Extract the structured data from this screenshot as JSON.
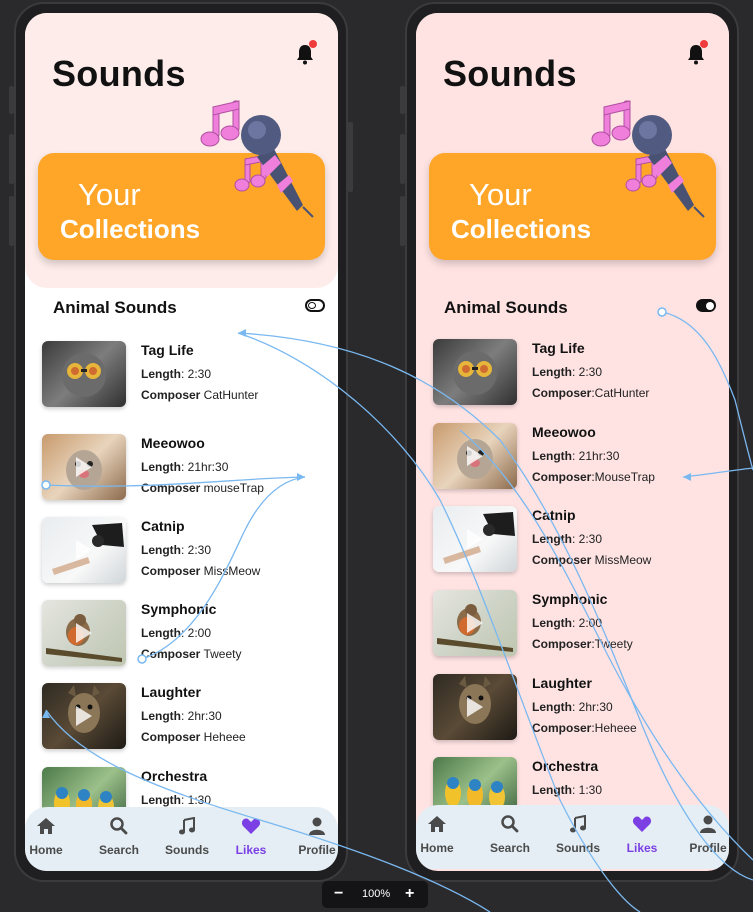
{
  "screens": [
    {
      "title": "Sounds",
      "collection": {
        "line1": "Your",
        "line2": "Collections"
      },
      "section_title": "Animal Sounds",
      "toggle_on": false,
      "sounds": [
        {
          "name": "Tag Life",
          "length_label": "Length",
          "length_value": ":  2:30",
          "composer_label": "Composer",
          "composer_value": " CatHunter"
        },
        {
          "name": "Meeowoo",
          "length_label": "Length",
          "length_value": ":  21hr:30",
          "composer_label": "Composer",
          "composer_value": " mouseTrap"
        },
        {
          "name": "Catnip",
          "length_label": "Length",
          "length_value": ":  2:30",
          "composer_label": "Composer",
          "composer_value": " MissMeow"
        },
        {
          "name": "Symphonic",
          "length_label": "Length",
          "length_value": ":  2:00",
          "composer_label": "Composer",
          "composer_value": " Tweety"
        },
        {
          "name": "Laughter",
          "length_label": "Length",
          "length_value": ":  2hr:30",
          "composer_label": "Composer",
          "composer_value": " Heheee"
        },
        {
          "name": "Orchestra",
          "length_label": "Length",
          "length_value": ":  1:30",
          "composer_label": "",
          "composer_value": ""
        }
      ],
      "nav": [
        {
          "label": "Home",
          "icon": "home-icon",
          "active": false
        },
        {
          "label": "Search",
          "icon": "search-icon",
          "active": false
        },
        {
          "label": "Sounds",
          "icon": "music-note-icon",
          "active": false
        },
        {
          "label": "Likes",
          "icon": "heart-icon",
          "active": true
        },
        {
          "label": "Profile",
          "icon": "profile-icon",
          "active": false
        }
      ]
    },
    {
      "title": "Sounds",
      "collection": {
        "line1": "Your",
        "line2": "Collections"
      },
      "section_title": "Animal Sounds",
      "toggle_on": true,
      "sounds": [
        {
          "name": "Tag Life",
          "length_label": "Length",
          "length_value": ":  2:30",
          "composer_label": "Composer",
          "composer_value": ":CatHunter"
        },
        {
          "name": "Meeowoo",
          "length_label": "Length",
          "length_value": ":  21hr:30",
          "composer_label": "Composer",
          "composer_value": ":MouseTrap"
        },
        {
          "name": "Catnip",
          "length_label": "Length",
          "length_value": ":  2:30",
          "composer_label": "Composer",
          "composer_value": " MissMeow"
        },
        {
          "name": "Symphonic",
          "length_label": "Length",
          "length_value": ":  2:00",
          "composer_label": "Composer",
          "composer_value": ":Tweety"
        },
        {
          "name": "Laughter",
          "length_label": "Length",
          "length_value": ":  2hr:30",
          "composer_label": "Composer",
          "composer_value": ":Heheee"
        },
        {
          "name": "Orchestra",
          "length_label": "Length",
          "length_value": ":  1:30",
          "composer_label": "",
          "composer_value": ""
        }
      ],
      "nav": [
        {
          "label": "Home",
          "icon": "home-icon",
          "active": false
        },
        {
          "label": "Search",
          "icon": "search-icon",
          "active": false
        },
        {
          "label": "Sounds",
          "icon": "music-note-icon",
          "active": false
        },
        {
          "label": "Likes",
          "icon": "heart-icon",
          "active": true
        },
        {
          "label": "Profile",
          "icon": "profile-icon",
          "active": false
        }
      ]
    }
  ],
  "zoom": {
    "minus": "−",
    "value": "100%",
    "plus": "+"
  },
  "colors": {
    "accent_orange": "#ffa629",
    "active_purple": "#7b3fe4",
    "notification_red": "#ef3b3b",
    "wire_blue": "#7ab8f0"
  }
}
